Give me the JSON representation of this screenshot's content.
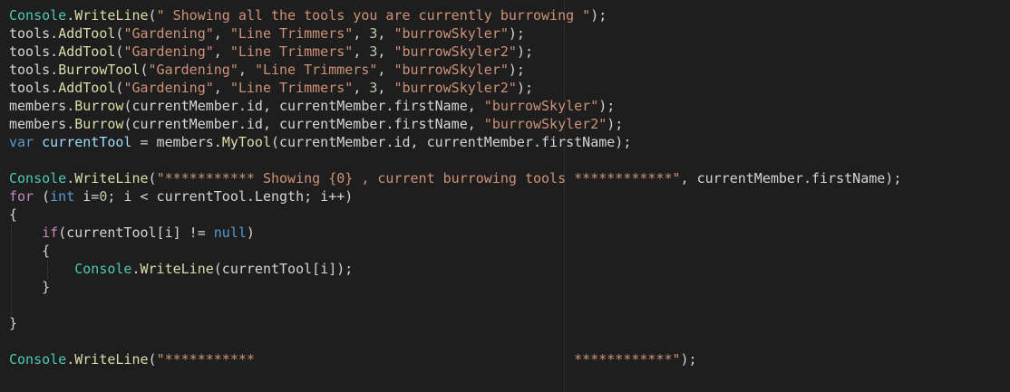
{
  "editor": {
    "colors": {
      "background": "#1e1e1e",
      "type": "#4ec9b0",
      "method": "#dcdcaa",
      "string": "#ce9178",
      "number": "#b5cea8",
      "keyword": "#569cd6",
      "control": "#c586c0",
      "variable": "#9cdcfe",
      "plain": "#d4d4d4"
    },
    "lines": [
      [
        [
          "cls",
          "Console"
        ],
        [
          "txt",
          "."
        ],
        [
          "fn",
          "WriteLine"
        ],
        [
          "txt",
          "("
        ],
        [
          "str",
          "\" Showing all the tools you are currently burrowing \""
        ],
        [
          "txt",
          ");"
        ]
      ],
      [
        [
          "txt",
          "tools."
        ],
        [
          "fn",
          "AddTool"
        ],
        [
          "txt",
          "("
        ],
        [
          "str",
          "\"Gardening\""
        ],
        [
          "txt",
          ", "
        ],
        [
          "str",
          "\"Line Trimmers\""
        ],
        [
          "txt",
          ", "
        ],
        [
          "num",
          "3"
        ],
        [
          "txt",
          ", "
        ],
        [
          "str",
          "\"burrowSkyler\""
        ],
        [
          "txt",
          ");"
        ]
      ],
      [
        [
          "txt",
          "tools."
        ],
        [
          "fn",
          "AddTool"
        ],
        [
          "txt",
          "("
        ],
        [
          "str",
          "\"Gardening\""
        ],
        [
          "txt",
          ", "
        ],
        [
          "str",
          "\"Line Trimmers\""
        ],
        [
          "txt",
          ", "
        ],
        [
          "num",
          "3"
        ],
        [
          "txt",
          ", "
        ],
        [
          "str",
          "\"burrowSkyler2\""
        ],
        [
          "txt",
          ");"
        ]
      ],
      [
        [
          "txt",
          "tools."
        ],
        [
          "fn",
          "BurrowTool"
        ],
        [
          "txt",
          "("
        ],
        [
          "str",
          "\"Gardening\""
        ],
        [
          "txt",
          ", "
        ],
        [
          "str",
          "\"Line Trimmers\""
        ],
        [
          "txt",
          ", "
        ],
        [
          "str",
          "\"burrowSkyler\""
        ],
        [
          "txt",
          ");"
        ]
      ],
      [
        [
          "txt",
          "tools."
        ],
        [
          "fn",
          "AddTool"
        ],
        [
          "txt",
          "("
        ],
        [
          "str",
          "\"Gardening\""
        ],
        [
          "txt",
          ", "
        ],
        [
          "str",
          "\"Line Trimmers\""
        ],
        [
          "txt",
          ", "
        ],
        [
          "num",
          "3"
        ],
        [
          "txt",
          ", "
        ],
        [
          "str",
          "\"burrowSkyler2\""
        ],
        [
          "txt",
          ");"
        ]
      ],
      [
        [
          "txt",
          "members."
        ],
        [
          "fn",
          "Burrow"
        ],
        [
          "txt",
          "(currentMember.id, currentMember.firstName, "
        ],
        [
          "str",
          "\"burrowSkyler\""
        ],
        [
          "txt",
          ");"
        ]
      ],
      [
        [
          "txt",
          "members."
        ],
        [
          "fn",
          "Burrow"
        ],
        [
          "txt",
          "(currentMember.id, currentMember.firstName, "
        ],
        [
          "str",
          "\"burrowSkyler2\""
        ],
        [
          "txt",
          ");"
        ]
      ],
      [
        [
          "kw",
          "var"
        ],
        [
          "txt",
          " "
        ],
        [
          "var",
          "currentTool"
        ],
        [
          "txt",
          " = members."
        ],
        [
          "fn",
          "MyTool"
        ],
        [
          "txt",
          "(currentMember.id, currentMember.firstName);"
        ]
      ],
      [],
      [
        [
          "cls",
          "Console"
        ],
        [
          "txt",
          "."
        ],
        [
          "fn",
          "WriteLine"
        ],
        [
          "txt",
          "("
        ],
        [
          "str",
          "\"*********** Showing {0} , current burrowing tools ************\""
        ],
        [
          "txt",
          ", currentMember.firstName);"
        ]
      ],
      [
        [
          "ctl",
          "for"
        ],
        [
          "txt",
          " ("
        ],
        [
          "kw",
          "int"
        ],
        [
          "txt",
          " i="
        ],
        [
          "num",
          "0"
        ],
        [
          "txt",
          "; i < currentTool.Length; i++)"
        ]
      ],
      [
        [
          "txt",
          "{"
        ]
      ],
      [
        [
          "txt",
          "    "
        ],
        [
          "ctl",
          "if"
        ],
        [
          "txt",
          "(currentTool[i] != "
        ],
        [
          "kw",
          "null"
        ],
        [
          "txt",
          ")"
        ]
      ],
      [
        [
          "txt",
          "    {"
        ]
      ],
      [
        [
          "txt",
          "        "
        ],
        [
          "cls",
          "Console"
        ],
        [
          "txt",
          "."
        ],
        [
          "fn",
          "WriteLine"
        ],
        [
          "txt",
          "(currentTool[i]);"
        ]
      ],
      [
        [
          "txt",
          "    }"
        ]
      ],
      [],
      [
        [
          "txt",
          "}"
        ]
      ],
      [],
      [
        [
          "cls",
          "Console"
        ],
        [
          "txt",
          "."
        ],
        [
          "fn",
          "WriteLine"
        ],
        [
          "txt",
          "("
        ],
        [
          "str",
          "\"***********                                       ************\""
        ],
        [
          "txt",
          ");"
        ]
      ]
    ]
  }
}
